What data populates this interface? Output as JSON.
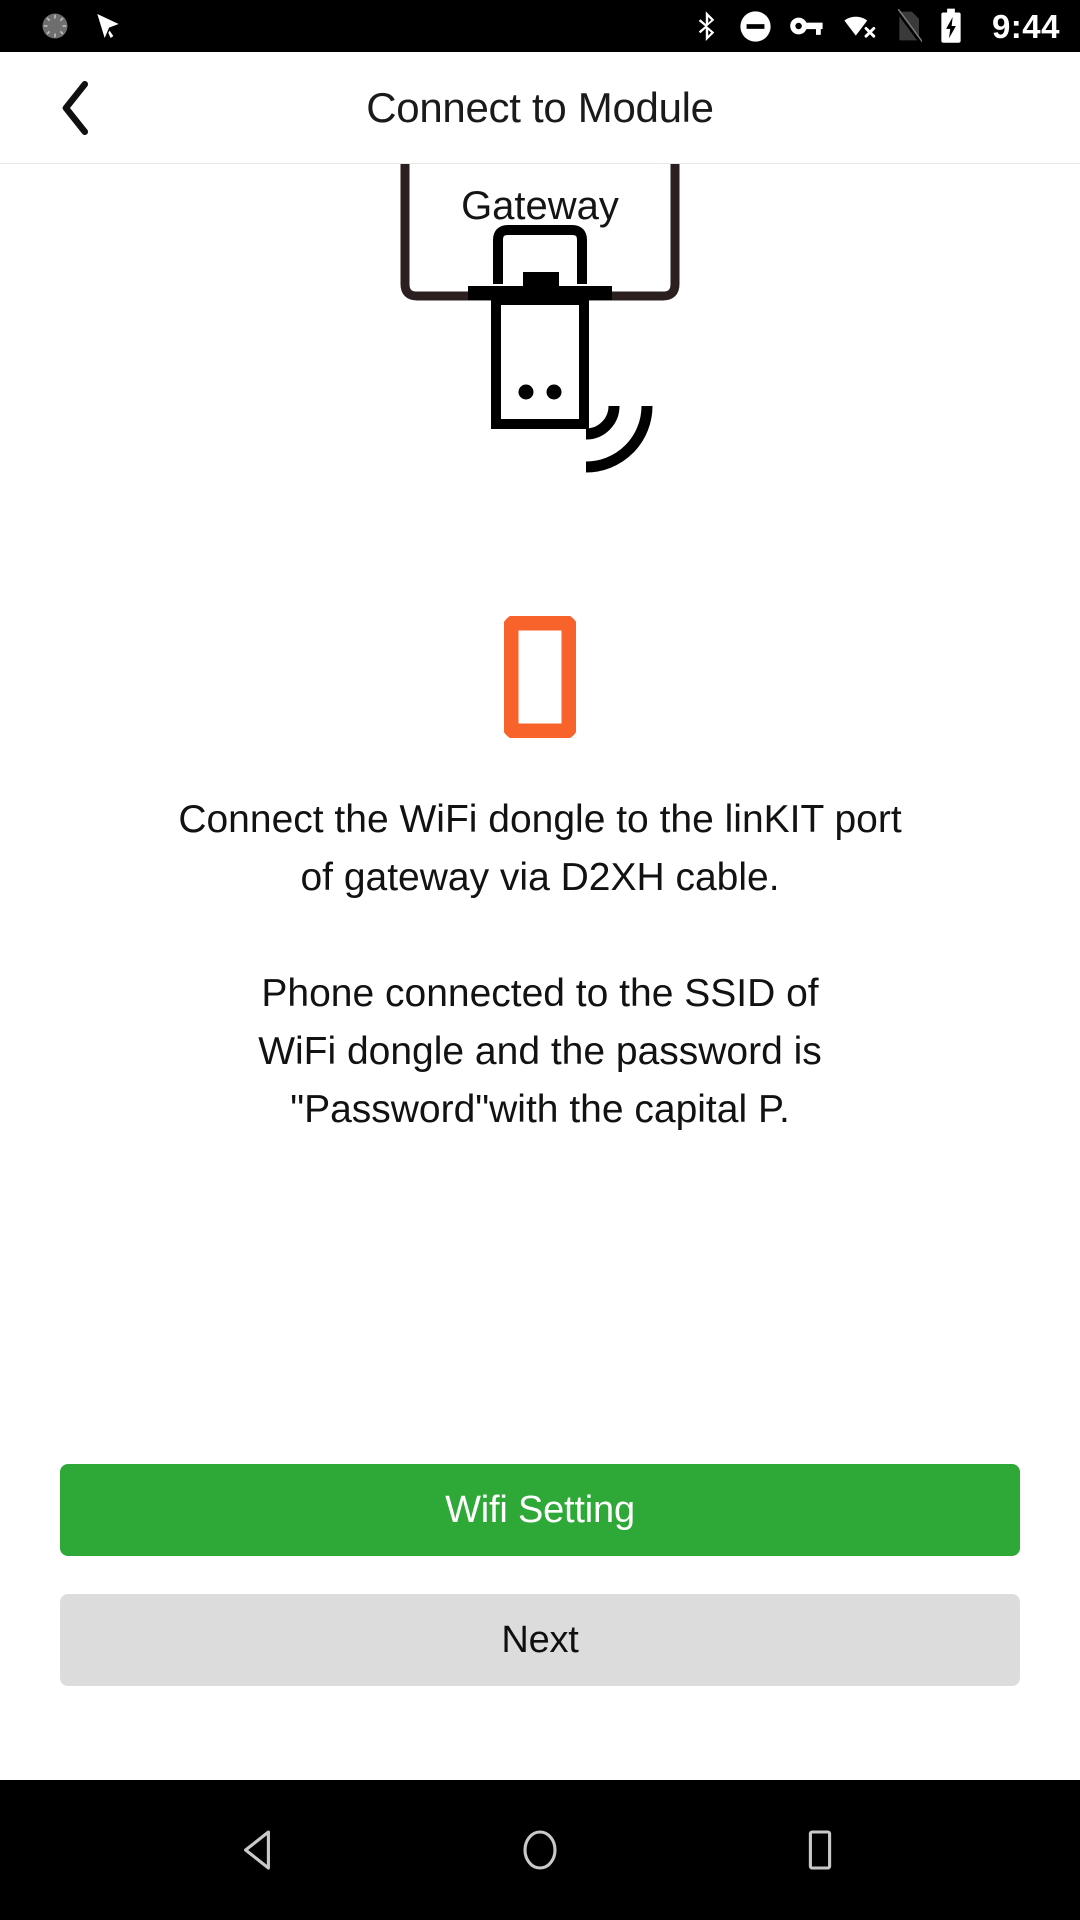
{
  "statusbar": {
    "left_icons": [
      {
        "name": "sync-spinner-icon",
        "label": "sync"
      },
      {
        "name": "location-cursor-icon",
        "label": "location"
      }
    ],
    "right_icons": [
      {
        "name": "bluetooth-icon",
        "label": "bluetooth"
      },
      {
        "name": "do-not-disturb-icon",
        "label": "do not disturb"
      },
      {
        "name": "vpn-key-icon",
        "label": "vpn"
      },
      {
        "name": "wifi-disconnected-icon",
        "label": "wifi no internet"
      },
      {
        "name": "sim-card-off-icon",
        "label": "no sim"
      },
      {
        "name": "battery-charging-icon",
        "label": "battery charging"
      }
    ],
    "time": "9:44"
  },
  "appbar": {
    "back_label": "‹",
    "title": "Connect to Module"
  },
  "illustration": {
    "gateway_label": "Gateway",
    "dongle_name": "wifi-dongle",
    "wifi_waves_name": "wifi-signal-waves",
    "phone_name": "orange-phone-outline",
    "colors": {
      "gateway_outline": "#2b201f",
      "dongle": "#000000",
      "phone": "#f7632a"
    }
  },
  "main": {
    "paragraph1_line1": "Connect the WiFi dongle to the linKIT port",
    "paragraph1_line2": "of gateway via D2XH cable.",
    "paragraph2_line1": "Phone connected to the SSID of",
    "paragraph2_line2": "WiFi dongle and the password is",
    "paragraph2_line3": "\"Password\"with the capital P."
  },
  "buttons": {
    "primary_label": "Wifi Setting",
    "primary_color": "#2ea836",
    "secondary_label": "Next",
    "secondary_color": "#dcdcdc"
  },
  "navbar": {
    "items": [
      {
        "name": "nav-back-icon",
        "label": "back"
      },
      {
        "name": "nav-home-icon",
        "label": "home"
      },
      {
        "name": "nav-recents-icon",
        "label": "recents"
      }
    ]
  }
}
